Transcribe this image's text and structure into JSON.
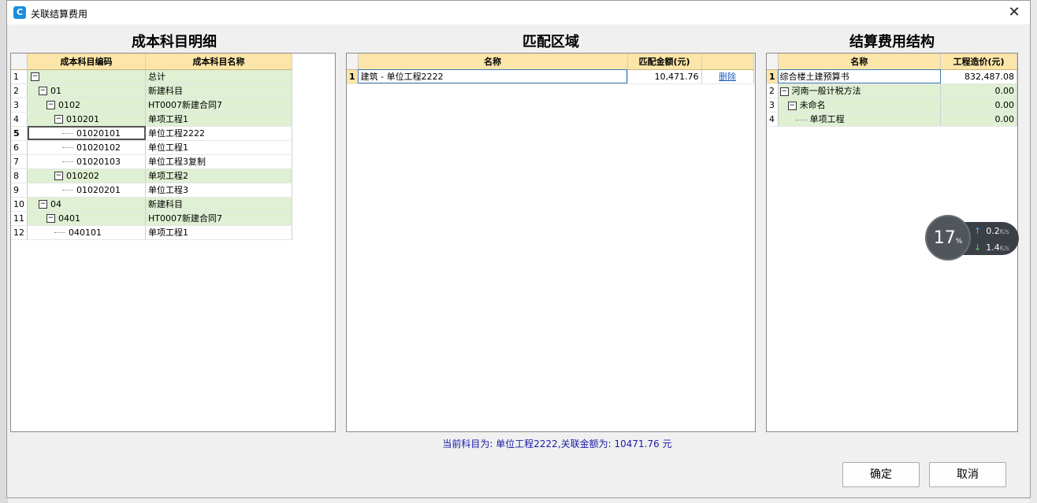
{
  "window": {
    "title": "关联结算费用",
    "icon": "app-icon",
    "close": "✕"
  },
  "left": {
    "title": "成本科目明细",
    "headers": [
      "成本科目编码",
      "成本科目名称"
    ],
    "rows": [
      {
        "n": "1",
        "code": "",
        "name": "总计",
        "level": 0,
        "toggle": true
      },
      {
        "n": "2",
        "code": "01",
        "name": "新建科目",
        "level": 1,
        "toggle": true
      },
      {
        "n": "3",
        "code": "0102",
        "name": "HT0007新建合同7",
        "level": 2,
        "toggle": true
      },
      {
        "n": "4",
        "code": "010201",
        "name": "单项工程1",
        "level": 3,
        "toggle": true
      },
      {
        "n": "5",
        "code": "01020101",
        "name": "单位工程2222",
        "level": 4,
        "toggle": false
      },
      {
        "n": "6",
        "code": "01020102",
        "name": "单位工程1",
        "level": 4,
        "toggle": false
      },
      {
        "n": "7",
        "code": "01020103",
        "name": "单位工程3复制",
        "level": 4,
        "toggle": false
      },
      {
        "n": "8",
        "code": "010202",
        "name": "单项工程2",
        "level": 3,
        "toggle": true
      },
      {
        "n": "9",
        "code": "01020201",
        "name": "单位工程3",
        "level": 4,
        "toggle": false
      },
      {
        "n": "10",
        "code": "04",
        "name": "新建科目",
        "level": 1,
        "toggle": true
      },
      {
        "n": "11",
        "code": "0401",
        "name": "HT0007新建合同7",
        "level": 2,
        "toggle": true
      },
      {
        "n": "12",
        "code": "040101",
        "name": "单项工程1",
        "level": 3,
        "toggle": false
      }
    ]
  },
  "middle": {
    "title": "匹配区域",
    "headers": [
      "名称",
      "匹配金额(元)",
      ""
    ],
    "rows": [
      {
        "n": "1",
        "name": "建筑 - 单位工程2222",
        "amount": "10,471.76",
        "action": "删除"
      }
    ]
  },
  "right": {
    "title": "结算费用结构",
    "headers": [
      "名称",
      "工程造价(元)"
    ],
    "rows": [
      {
        "n": "1",
        "name": "综合楼土建预算书",
        "amount": "832,487.08",
        "level": 0,
        "toggle": false
      },
      {
        "n": "2",
        "name": "河南一般计税方法",
        "amount": "0.00",
        "level": 0,
        "toggle": true
      },
      {
        "n": "3",
        "name": "未命名",
        "amount": "0.00",
        "level": 1,
        "toggle": true
      },
      {
        "n": "4",
        "name": "单项工程",
        "amount": "0.00",
        "level": 2,
        "toggle": false
      }
    ]
  },
  "status": "当前科目为: 单位工程2222,关联金额为: 10471.76 元",
  "buttons": {
    "ok": "确定",
    "cancel": "取消"
  },
  "widget": {
    "percent": "17",
    "percent_unit": "%",
    "up": "0.2",
    "down": "1.4",
    "unit": "K/s"
  }
}
